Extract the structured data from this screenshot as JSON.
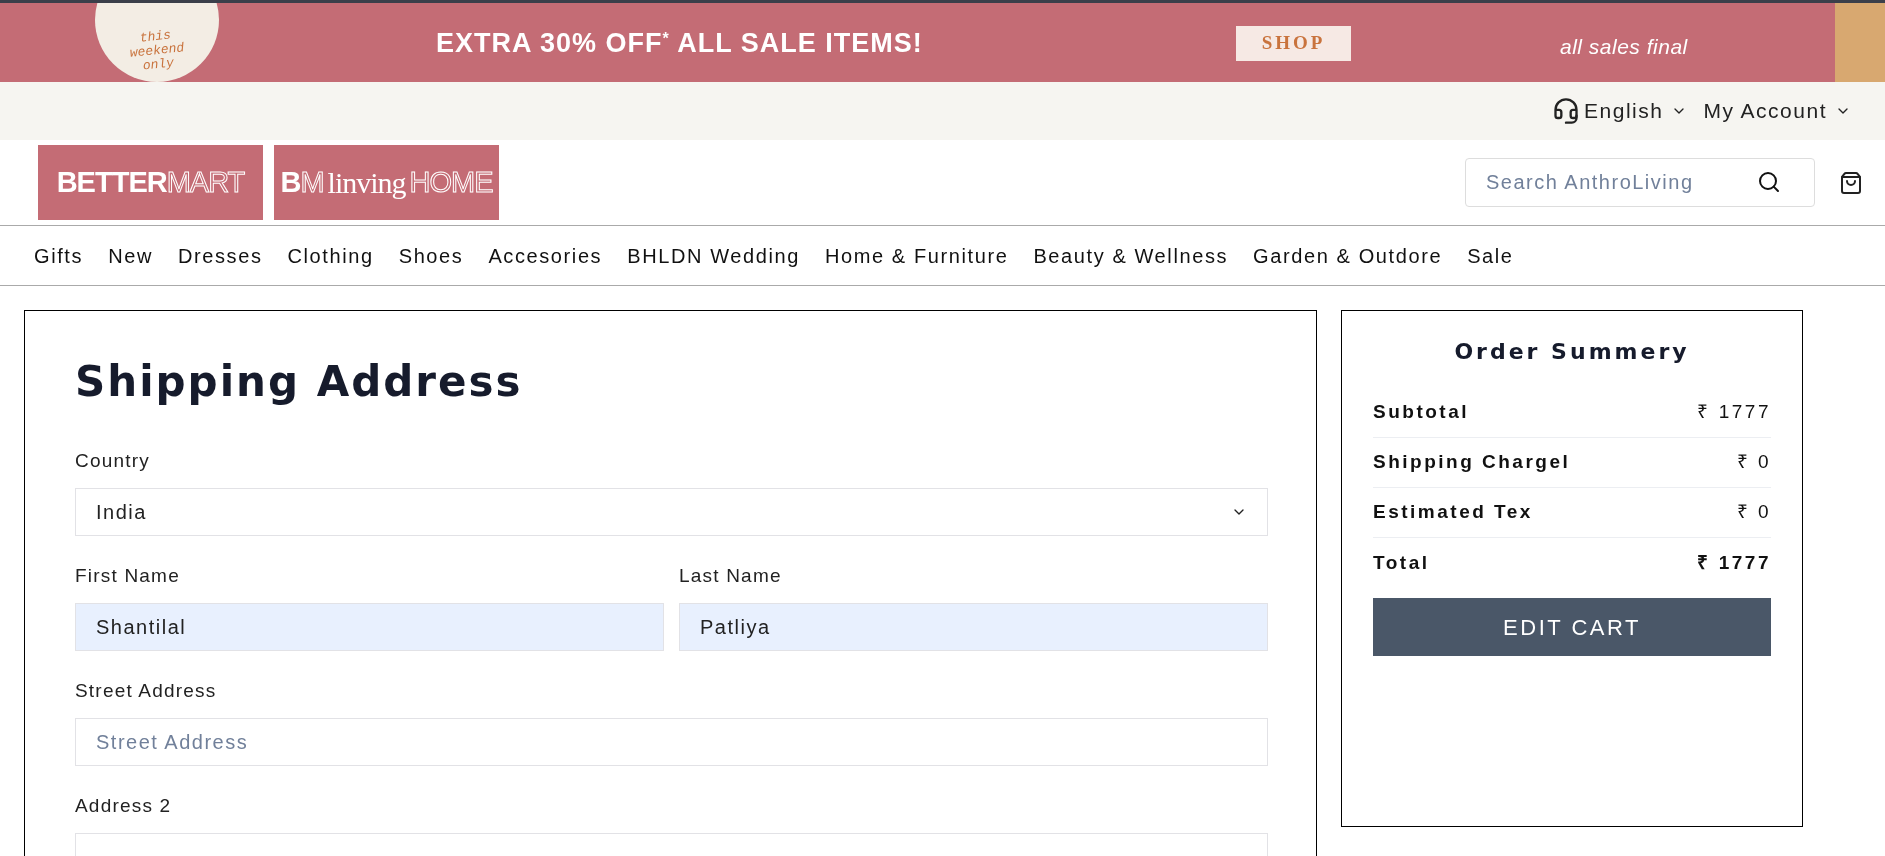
{
  "promo_banner": {
    "badge": "this weekend only",
    "headline": "EXTRA **30% OFF**$^{*}$ ALL SALE ITEMS!",
    "shop_button": "SHOP",
    "note": "all sales final"
  },
  "utility_bar": {
    "language": "English",
    "account": "My Account"
  },
  "logos": [
    {
      "parts": [
        {
          "text": "BETTER",
          "kind": "solid"
        },
        {
          "text": "MART",
          "kind": "outline"
        }
      ]
    },
    {
      "parts": [
        {
          "text": "B",
          "kind": "solid"
        },
        {
          "text": "M",
          "kind": "outline"
        },
        {
          "text": "linving",
          "kind": "script"
        },
        {
          "text": "HOME",
          "kind": "outline"
        }
      ]
    }
  ],
  "search": {
    "placeholder": "Search AnthroLiving"
  },
  "nav": [
    "Gifts",
    "New",
    "Dresses",
    "Clothing",
    "Shoes",
    "Accesories",
    "BHLDN Wedding",
    "Home & Furniture",
    "Beauty & Wellness",
    "Garden & Outdore",
    "Sale"
  ],
  "shipping_form": {
    "title": "Shipping Address",
    "rows": [
      [
        {
          "label": "Country",
          "kind": "select",
          "value": "India",
          "autofilled": false
        }
      ],
      [
        {
          "label": "First Name",
          "kind": "text",
          "value": "Shantilal",
          "autofilled": true
        },
        {
          "label": "Last Name",
          "kind": "text",
          "value": "Patliya",
          "autofilled": true
        }
      ],
      [
        {
          "label": "Street Address",
          "kind": "text",
          "placeholder": "Street Address",
          "autofilled": false
        }
      ],
      [
        {
          "label": "Address 2",
          "kind": "text",
          "autofilled": false
        }
      ]
    ]
  },
  "order_summary": {
    "title": "Order Summery",
    "lines": [
      {
        "label": "Subtotal",
        "amount": "₹ 1777",
        "total": false
      },
      {
        "label": "Shipping Chargel",
        "amount": "₹ 0",
        "total": false
      },
      {
        "label": "Estimated Tex",
        "amount": "₹ 0",
        "total": false
      },
      {
        "label": "Total",
        "amount": "₹ 1777",
        "total": true
      }
    ],
    "button": "EDIT CART"
  }
}
